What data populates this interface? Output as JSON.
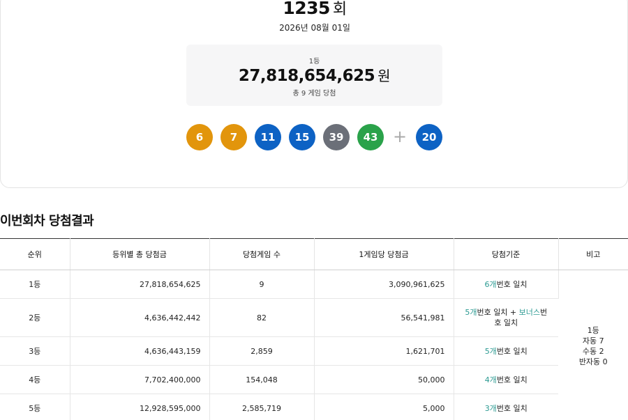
{
  "draw": {
    "round_number": "1235",
    "round_unit": "회",
    "date": "2026년 08월 01일",
    "prize_rank": "1등",
    "prize_amount": "27,818,654,625",
    "prize_currency": "원",
    "winner_text": "총 9 게임 당첨"
  },
  "balls": [
    {
      "number": "6",
      "color": "#e2950c"
    },
    {
      "number": "7",
      "color": "#e2950c"
    },
    {
      "number": "11",
      "color": "#0d62c4"
    },
    {
      "number": "15",
      "color": "#0d62c4"
    },
    {
      "number": "39",
      "color": "#6b6f78"
    },
    {
      "number": "43",
      "color": "#2aa24a"
    }
  ],
  "plus_sign": "+",
  "bonus_ball": {
    "number": "20",
    "color": "#0d62c4"
  },
  "section_title": "이번회차 당첨결과",
  "table": {
    "headers": [
      "순위",
      "등위별 총 당첨금",
      "당첨게임 수",
      "1게임당 당첨금",
      "당첨기준",
      "비고"
    ],
    "rows": [
      {
        "rank": "1등",
        "total": "27,818,654,625",
        "games": "9",
        "per_game": "3,090,961,625",
        "criteria_count": "6개",
        "criteria_text": "번호 일치",
        "bonus_prefix": "",
        "bonus_word": "",
        "bonus_suffix": ""
      },
      {
        "rank": "2등",
        "total": "4,636,442,442",
        "games": "82",
        "per_game": "56,541,981",
        "criteria_count": "5개",
        "criteria_text": "번호 일치",
        "bonus_prefix": " + ",
        "bonus_word": "보너스",
        "bonus_suffix": "번호 일치"
      },
      {
        "rank": "3등",
        "total": "4,636,443,159",
        "games": "2,859",
        "per_game": "1,621,701",
        "criteria_count": "5개",
        "criteria_text": "번호 일치",
        "bonus_prefix": "",
        "bonus_word": "",
        "bonus_suffix": ""
      },
      {
        "rank": "4등",
        "total": "7,702,400,000",
        "games": "154,048",
        "per_game": "50,000",
        "criteria_count": "4개",
        "criteria_text": "번호 일치",
        "bonus_prefix": "",
        "bonus_word": "",
        "bonus_suffix": ""
      },
      {
        "rank": "5등",
        "total": "12,928,595,000",
        "games": "2,585,719",
        "per_game": "5,000",
        "criteria_count": "3개",
        "criteria_text": "번호 일치",
        "bonus_prefix": "",
        "bonus_word": "",
        "bonus_suffix": ""
      }
    ],
    "remarks": [
      "1등",
      "자동 7",
      "수동 2",
      "반자동 0"
    ]
  }
}
